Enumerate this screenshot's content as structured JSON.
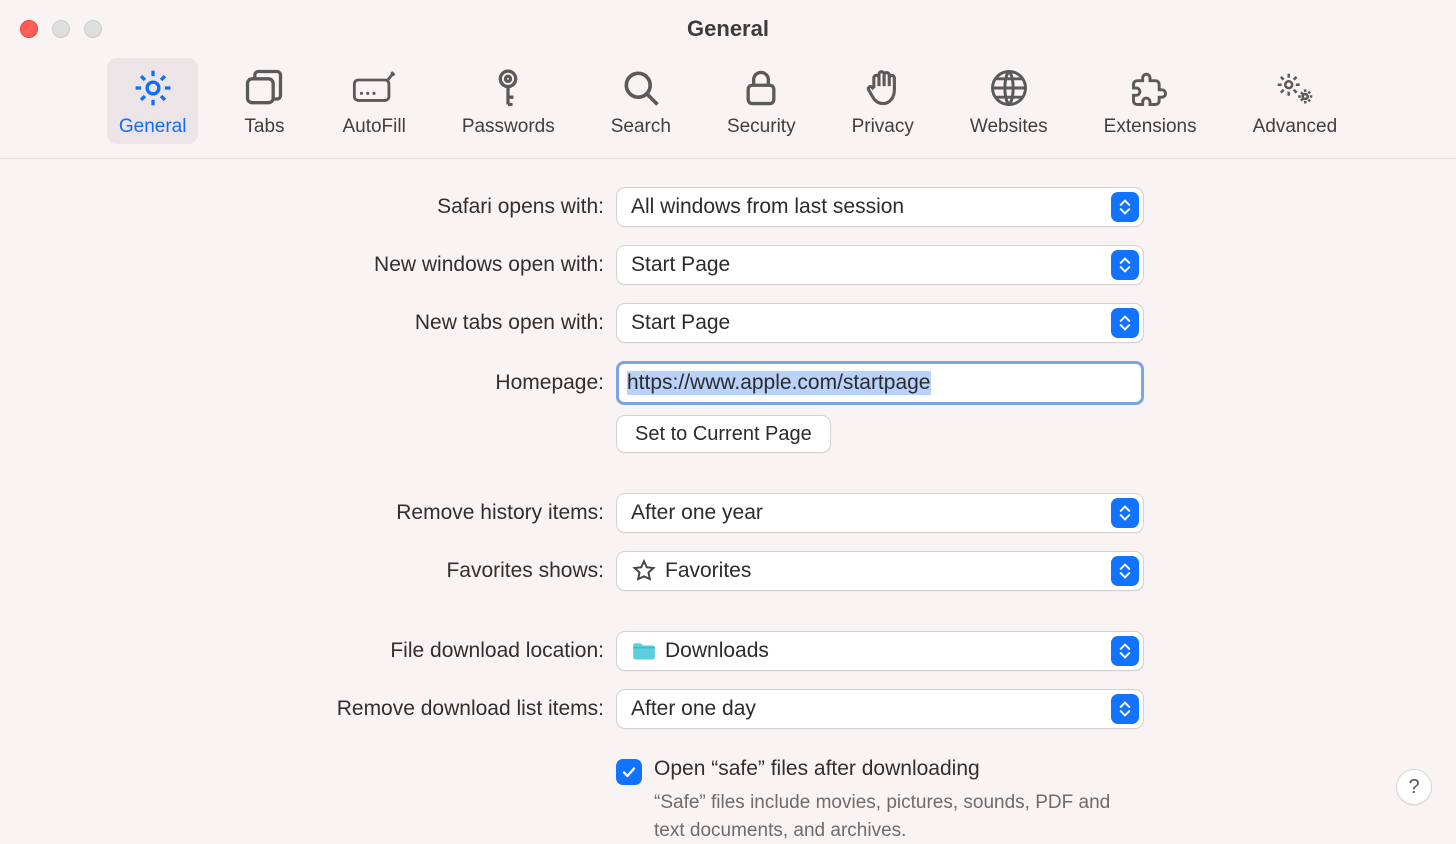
{
  "window": {
    "title": "General"
  },
  "tabs": [
    {
      "label": "General"
    },
    {
      "label": "Tabs"
    },
    {
      "label": "AutoFill"
    },
    {
      "label": "Passwords"
    },
    {
      "label": "Search"
    },
    {
      "label": "Security"
    },
    {
      "label": "Privacy"
    },
    {
      "label": "Websites"
    },
    {
      "label": "Extensions"
    },
    {
      "label": "Advanced"
    }
  ],
  "labels": {
    "safari_opens": "Safari opens with:",
    "new_windows": "New windows open with:",
    "new_tabs": "New tabs open with:",
    "homepage": "Homepage:",
    "set_current": "Set to Current Page",
    "remove_history": "Remove history items:",
    "favorites_shows": "Favorites shows:",
    "download_location": "File download location:",
    "remove_downloads": "Remove download list items:",
    "open_safe": "Open “safe” files after downloading",
    "safe_hint": "“Safe” files include movies, pictures, sounds, PDF and text documents, and archives."
  },
  "values": {
    "safari_opens": "All windows from last session",
    "new_windows": "Start Page",
    "new_tabs": "Start Page",
    "homepage": "https://www.apple.com/startpage",
    "remove_history": "After one year",
    "favorites_shows": "Favorites",
    "download_location": "Downloads",
    "remove_downloads": "After one day"
  },
  "help": "?"
}
